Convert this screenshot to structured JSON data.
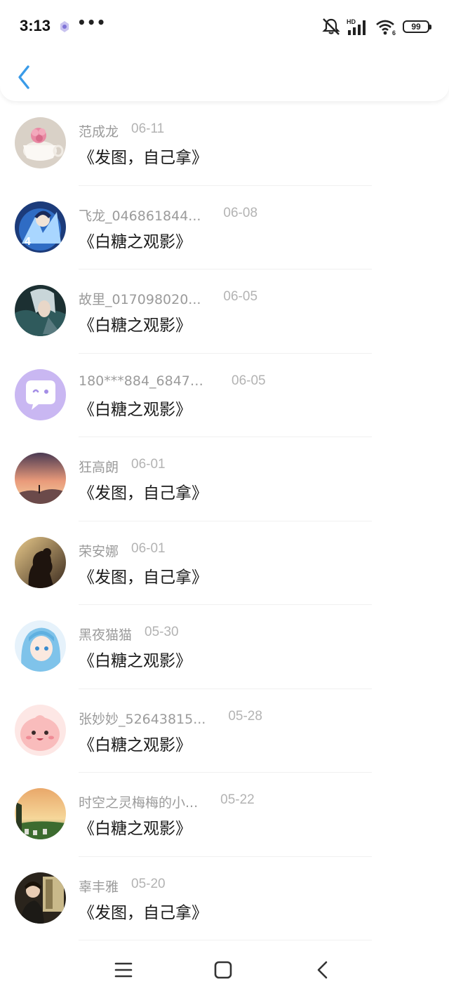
{
  "status_bar": {
    "time": "3:13",
    "dots": "•••",
    "battery": "99",
    "network": "HD",
    "wifi_sub": "6"
  },
  "header": {
    "back_icon": "chevron-left-icon",
    "accent_color": "#3a9be8"
  },
  "items": [
    {
      "name": "范成龙",
      "date": "06-11",
      "title": "《发图，自己拿》",
      "avatar": "teacup-flower"
    },
    {
      "name": "飞龙_046861844...",
      "date": "06-08",
      "title": "《白糖之观影》",
      "avatar": "anime-blue-warrior"
    },
    {
      "name": "故里_017098020...",
      "date": "06-05",
      "title": "《白糖之观影》",
      "avatar": "anime-silver-hair"
    },
    {
      "name": "180***884_68474...",
      "date": "06-05",
      "title": "《白糖之观影》",
      "avatar": "default-chat-bubble"
    },
    {
      "name": "狂高朗",
      "date": "06-01",
      "title": "《发图，自己拿》",
      "avatar": "sunset-landscape"
    },
    {
      "name": "荣安娜",
      "date": "06-01",
      "title": "《发图，自己拿》",
      "avatar": "girl-silhouette"
    },
    {
      "name": "黑夜猫猫",
      "date": "05-30",
      "title": "《白糖之观影》",
      "avatar": "anime-blue-hair-girl"
    },
    {
      "name": "张妙妙_52643815...",
      "date": "05-28",
      "title": "《白糖之观影》",
      "avatar": "pink-cartoon"
    },
    {
      "name": "时空之灵梅梅的小...",
      "date": "05-22",
      "title": "《白糖之观影》",
      "avatar": "sunset-field"
    },
    {
      "name": "辜丰雅",
      "date": "05-20",
      "title": "《发图，自己拿》",
      "avatar": "person-reading"
    }
  ],
  "navbar": {
    "menu_icon": "menu-icon",
    "home_icon": "home-square-icon",
    "back_icon": "back-triangle-icon"
  }
}
